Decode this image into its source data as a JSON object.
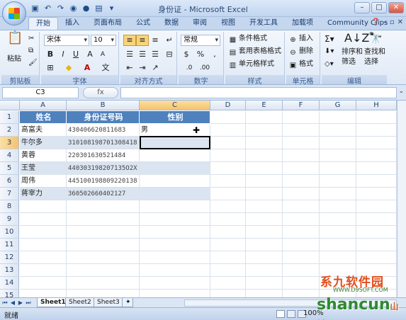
{
  "window": {
    "title": "身份证 - Microsoft Excel"
  },
  "tabs": [
    "开始",
    "插入",
    "页面布局",
    "公式",
    "数据",
    "审阅",
    "视图",
    "开发工具",
    "加载项",
    "Community Clips"
  ],
  "ribbon": {
    "clipboard": {
      "label": "剪贴板",
      "paste": "粘贴"
    },
    "font": {
      "label": "字体",
      "name": "宋体",
      "size": "10"
    },
    "alignment": {
      "label": "对齐方式"
    },
    "number": {
      "label": "数字",
      "format": "常规"
    },
    "styles": {
      "label": "样式",
      "conditional": "条件格式",
      "table": "套用表格格式",
      "cell": "单元格样式"
    },
    "cells": {
      "label": "单元格",
      "insert": "插入",
      "delete": "删除",
      "format": "格式"
    },
    "editing": {
      "label": "编辑",
      "sort": "排序和",
      "sort2": "筛选",
      "find": "查找和",
      "find2": "选择"
    }
  },
  "formula_bar": {
    "name_box": "C3",
    "fx": "fx",
    "content": ""
  },
  "grid": {
    "columns": [
      "A",
      "B",
      "C",
      "D",
      "E",
      "F",
      "G",
      "H"
    ],
    "rows": [
      "1",
      "2",
      "3",
      "4",
      "5",
      "6",
      "7",
      "8",
      "9",
      "10",
      "11",
      "12",
      "13",
      "14",
      "15",
      "16"
    ],
    "header": [
      "姓名",
      "身份证号码",
      "性别"
    ],
    "data": [
      [
        "高富夫",
        "430406620811683",
        "男"
      ],
      [
        "牛尔多",
        "310108198701308418",
        ""
      ],
      [
        "黄蓉",
        "220301630521484",
        ""
      ],
      [
        "王莹",
        "440303198207135O2X",
        ""
      ],
      [
        "周伟",
        "445100198809220138",
        ""
      ],
      [
        "蒋宰力",
        "360502660402127",
        ""
      ]
    ]
  },
  "sheets": [
    "Sheet1",
    "Sheet2",
    "Sheet3"
  ],
  "status": {
    "text": "就绪",
    "zoom": "100%"
  },
  "watermark": {
    "line1": "系九软件园",
    "line2": "WWW.D9SOFT.COM",
    "line3": "shancun",
    "line3b": "山村"
  }
}
